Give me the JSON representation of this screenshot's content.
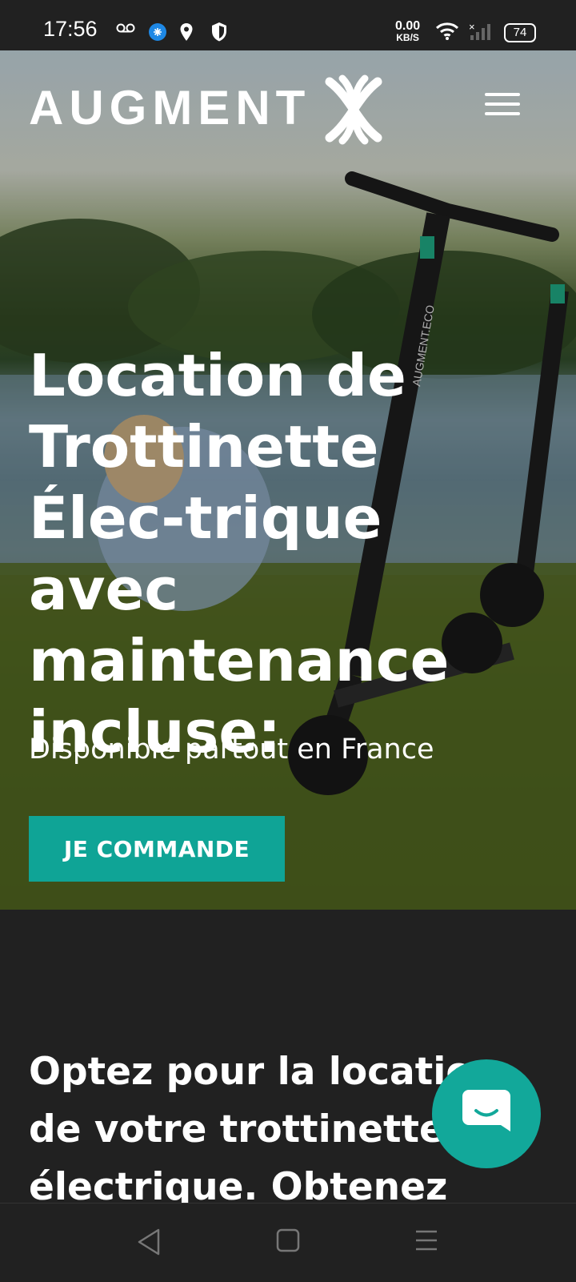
{
  "status_bar": {
    "time": "17:56",
    "speed_value": "0.00",
    "speed_unit": "KB/S",
    "battery": "74",
    "icons": [
      "voicemail-icon",
      "app-notification-icon",
      "location-icon",
      "shield-icon",
      "wifi-icon",
      "signal-icon",
      "battery-icon"
    ]
  },
  "header": {
    "logo_text": "AUGMENT",
    "menu_icon": "hamburger-menu-icon"
  },
  "hero": {
    "title": "Location de Trottinette Élec-trique avec maintenance incluse:",
    "subtitle": "Disponible partout en France",
    "cta_label": "JE COMMANDE",
    "scooter_brand": "AUGMENT.ECO"
  },
  "section2": {
    "title": "Optez pour la location de votre trottinette électrique. Obtenez"
  },
  "chat": {
    "icon": "chat-icon"
  },
  "navbar": {
    "icons": [
      "back-icon",
      "home-icon",
      "recents-icon"
    ]
  },
  "colors": {
    "accent": "#0fa496",
    "dark_bg": "#212121"
  }
}
